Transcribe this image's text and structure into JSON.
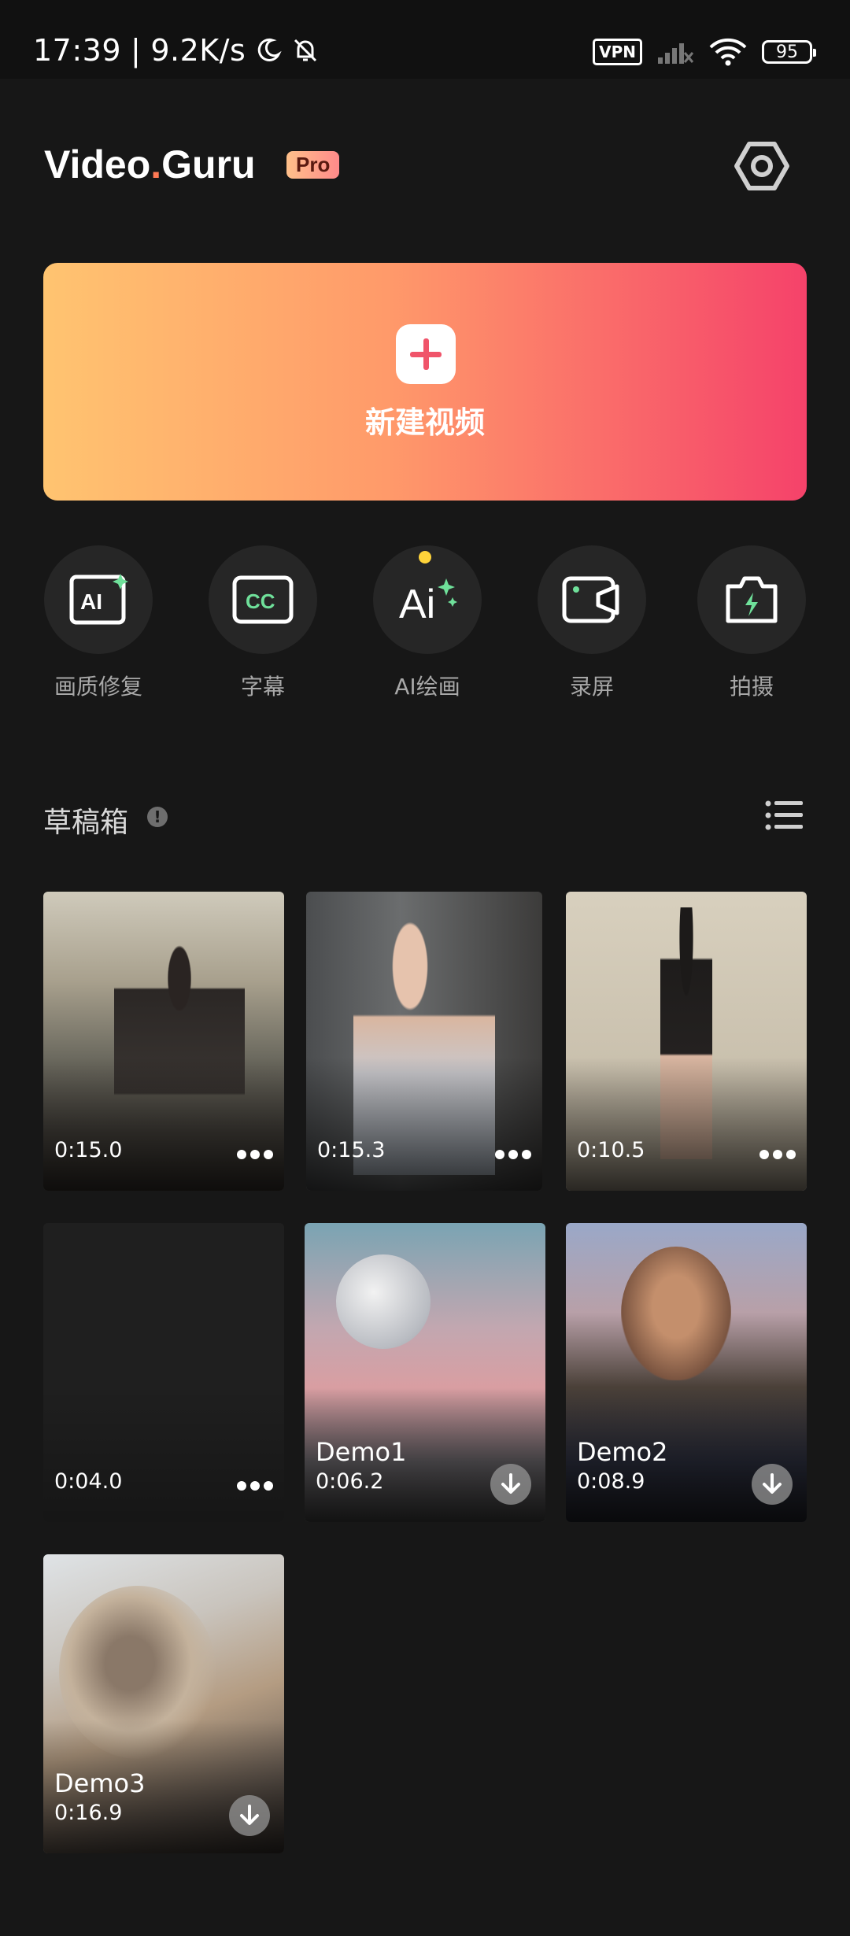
{
  "status_bar": {
    "time": "17:39",
    "network_speed": "9.2K/s",
    "vpn_label": "VPN",
    "battery": "95"
  },
  "header": {
    "logo_part1": "Video",
    "logo_part2": "Guru",
    "pro_badge": "Pro",
    "settings_icon": "settings-hexagon-icon"
  },
  "new_video": {
    "label": "新建视频"
  },
  "tools": [
    {
      "label": "画质修复",
      "icon": "ai-enhance-icon"
    },
    {
      "label": "字幕",
      "icon": "cc-subtitle-icon"
    },
    {
      "label": "AI绘画",
      "icon": "ai-paint-icon"
    },
    {
      "label": "录屏",
      "icon": "screen-record-icon"
    },
    {
      "label": "拍摄",
      "icon": "camera-icon"
    }
  ],
  "drafts": {
    "title": "草稿箱",
    "items": [
      {
        "duration": "0:15.0",
        "action": "more"
      },
      {
        "duration": "0:15.3",
        "action": "more"
      },
      {
        "duration": "0:10.5",
        "action": "more"
      },
      {
        "duration": "0:04.0",
        "action": "more"
      },
      {
        "name": "Demo1",
        "duration": "0:06.2",
        "action": "download"
      },
      {
        "name": "Demo2",
        "duration": "0:08.9",
        "action": "download"
      },
      {
        "name": "Demo3",
        "duration": "0:16.9",
        "action": "download"
      }
    ]
  },
  "colors": {
    "background": "#171717",
    "card_gradient_start": "#ffc470",
    "card_gradient_end": "#f5426a",
    "accent_dot": "#ffd43a",
    "logo_dot": "#ff7a55"
  }
}
